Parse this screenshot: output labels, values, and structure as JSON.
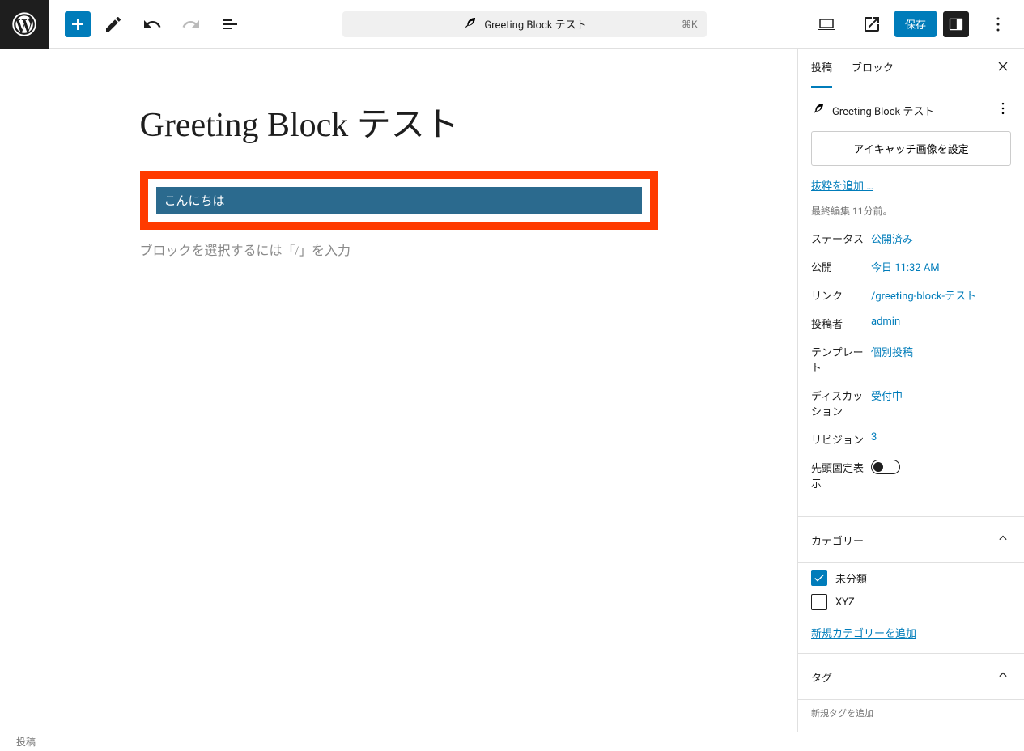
{
  "toolbar": {
    "doc_title": "Greeting Block テスト",
    "shortcut": "⌘K",
    "save_label": "保存"
  },
  "editor": {
    "title": "Greeting Block テスト",
    "greeting_text": "こんにちは",
    "placeholder": "ブロックを選択するには「/」を入力"
  },
  "sidebar": {
    "tabs": {
      "post": "投稿",
      "block": "ブロック"
    },
    "summary": {
      "title": "Greeting Block テスト",
      "featured_button": "アイキャッチ画像を設定",
      "excerpt_link": "抜粋を追加 …",
      "last_edit": "最終編集 11分前。"
    },
    "meta": {
      "status_label": "ステータス",
      "status_value": "公開済み",
      "publish_label": "公開",
      "publish_value": "今日 11:32 AM",
      "link_label": "リンク",
      "link_value": "/greeting-block-テスト",
      "author_label": "投稿者",
      "author_value": "admin",
      "template_label": "テンプレート",
      "template_value": "個別投稿",
      "discussion_label": "ディスカッション",
      "discussion_value": "受付中",
      "revisions_label": "リビジョン",
      "revisions_value": "3",
      "sticky_label": "先頭固定表示"
    },
    "categories": {
      "header": "カテゴリー",
      "items": [
        {
          "label": "未分類",
          "checked": true
        },
        {
          "label": "XYZ",
          "checked": false
        }
      ],
      "add_link": "新規カテゴリーを追加"
    },
    "tags": {
      "header": "タグ",
      "add_label": "新規タグを追加"
    }
  },
  "statusbar": {
    "text": "投稿"
  }
}
